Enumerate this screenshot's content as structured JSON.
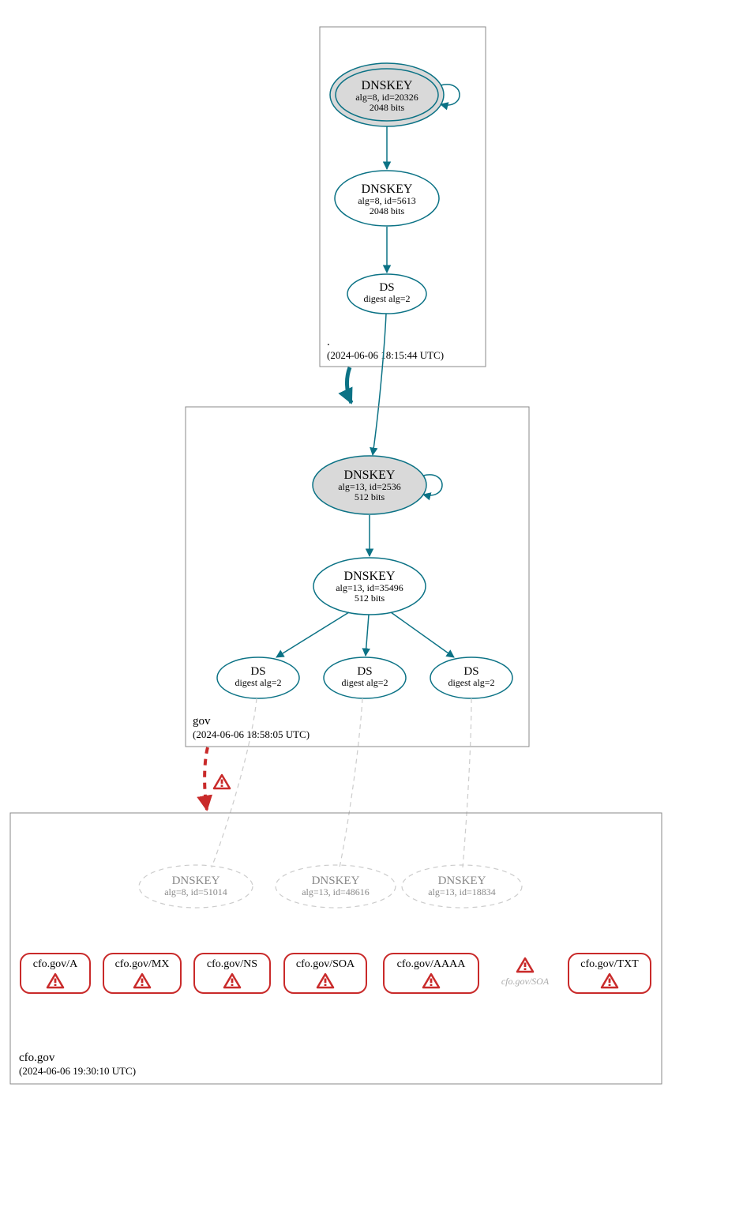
{
  "colors": {
    "teal": "#0b7285",
    "red": "#c92a2a",
    "gray": "#cccccc",
    "boxStroke": "#888888",
    "kskFill": "#d9d9d9"
  },
  "zones": {
    "root": {
      "label": ".",
      "timestamp": "(2024-06-06 18:15:44 UTC)",
      "nodes": {
        "ksk": {
          "title": "DNSKEY",
          "line2": "alg=8, id=20326",
          "line3": "2048 bits"
        },
        "zsk": {
          "title": "DNSKEY",
          "line2": "alg=8, id=5613",
          "line3": "2048 bits"
        },
        "ds": {
          "title": "DS",
          "line2": "digest alg=2"
        }
      }
    },
    "gov": {
      "label": "gov",
      "timestamp": "(2024-06-06 18:58:05 UTC)",
      "nodes": {
        "ksk": {
          "title": "DNSKEY",
          "line2": "alg=13, id=2536",
          "line3": "512 bits"
        },
        "zsk": {
          "title": "DNSKEY",
          "line2": "alg=13, id=35496",
          "line3": "512 bits"
        },
        "ds1": {
          "title": "DS",
          "line2": "digest alg=2"
        },
        "ds2": {
          "title": "DS",
          "line2": "digest alg=2"
        },
        "ds3": {
          "title": "DS",
          "line2": "digest alg=2"
        }
      }
    },
    "cfo": {
      "label": "cfo.gov",
      "timestamp": "(2024-06-06 19:30:10 UTC)",
      "nodes": {
        "dk1": {
          "title": "DNSKEY",
          "line2": "alg=8, id=51014"
        },
        "dk2": {
          "title": "DNSKEY",
          "line2": "alg=13, id=48616"
        },
        "dk3": {
          "title": "DNSKEY",
          "line2": "alg=13, id=18834"
        }
      },
      "records": {
        "a": "cfo.gov/A",
        "mx": "cfo.gov/MX",
        "ns": "cfo.gov/NS",
        "soa": "cfo.gov/SOA",
        "aaaa": "cfo.gov/AAAA",
        "soa2": "cfo.gov/SOA",
        "txt": "cfo.gov/TXT"
      }
    }
  }
}
